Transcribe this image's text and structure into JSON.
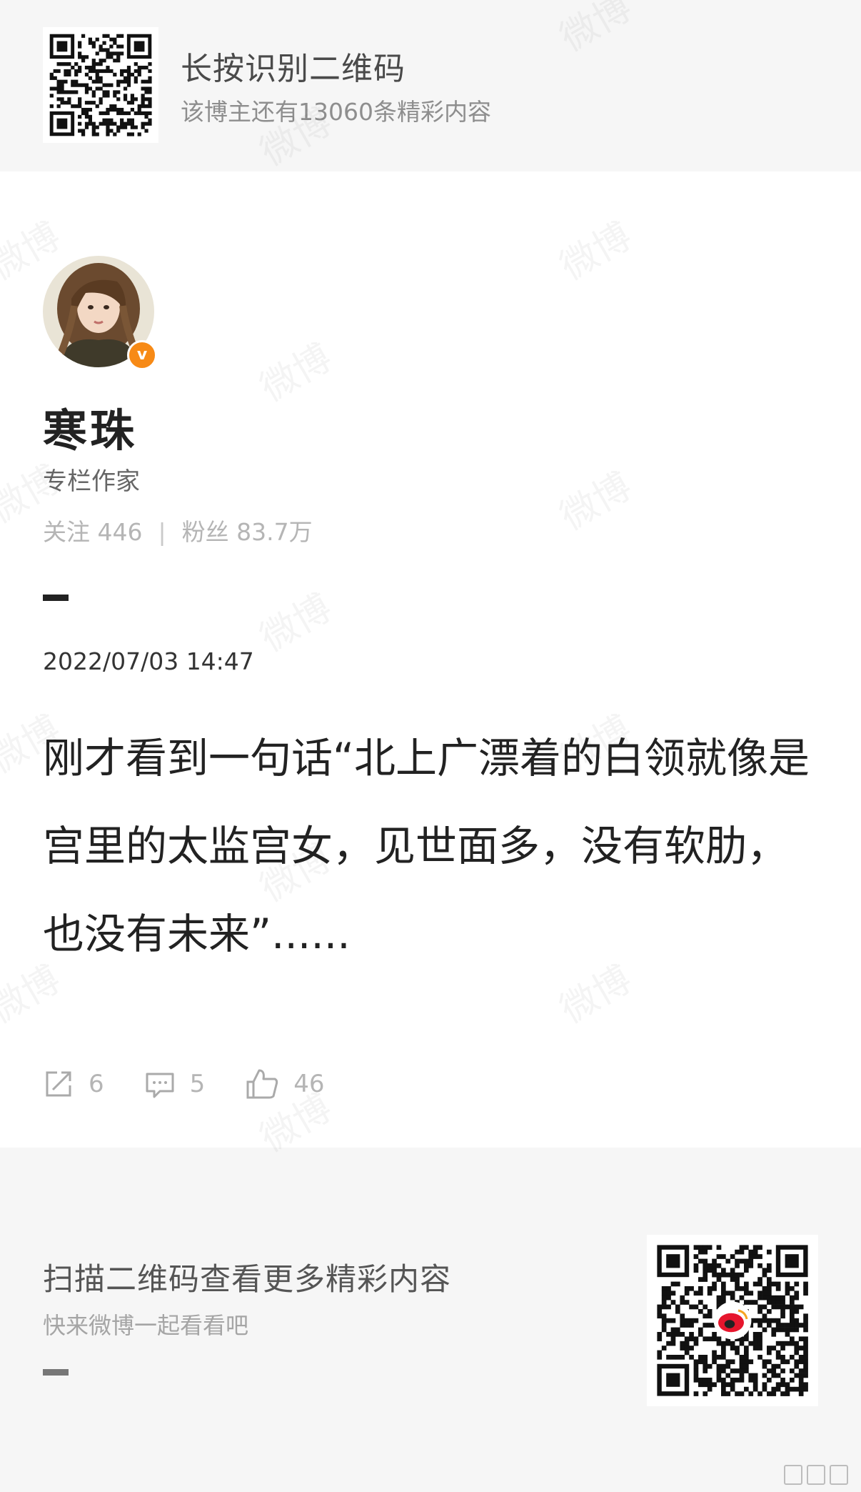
{
  "banner": {
    "title": "长按识别二维码",
    "subtitle": "该博主还有13060条精彩内容"
  },
  "profile": {
    "name": "寒珠",
    "title": "专栏作家",
    "verified_badge": "v",
    "following_label": "关注",
    "following_count": "446",
    "fans_label": "粉丝",
    "fans_count": "83.7万",
    "avatar_icon": "female-avatar-illustration"
  },
  "post": {
    "date": "2022/07/03 14:47",
    "text": "刚才看到一句话“北上广漂着的白领就像是宫里的太监宫女，见世面多，没有软肋，也没有未来”......",
    "reposts": "6",
    "comments": "5",
    "likes": "46",
    "icons": [
      "share-icon",
      "comment-icon",
      "like-icon"
    ]
  },
  "footer": {
    "title": "扫描二维码查看更多精彩内容",
    "subtitle": "快来微博一起看看吧"
  },
  "watermark_text": "微博",
  "colors": {
    "panel_bg": "#f6f6f6",
    "verified_orange": "#f78a16",
    "weibo_red": "#e6162d"
  }
}
